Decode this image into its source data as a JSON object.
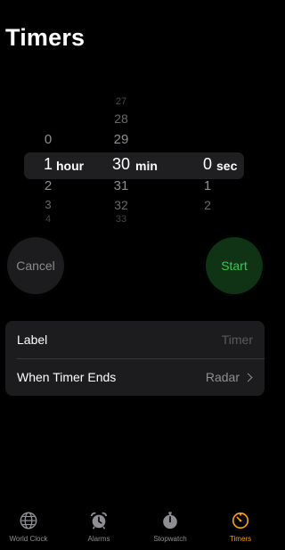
{
  "header": {
    "title": "Timers"
  },
  "picker": {
    "hours": {
      "above": [
        "0"
      ],
      "selected": "1",
      "unit": "hour",
      "below": [
        "2",
        "3",
        "4"
      ]
    },
    "minutes": {
      "above": [
        "27",
        "28",
        "29"
      ],
      "selected": "30",
      "unit": "min",
      "below": [
        "31",
        "32",
        "33"
      ]
    },
    "seconds": {
      "above": [],
      "selected": "0",
      "unit": "sec",
      "below": [
        "1",
        "2"
      ]
    }
  },
  "buttons": {
    "cancel": "Cancel",
    "start": "Start"
  },
  "settings": {
    "label": {
      "title": "Label",
      "placeholder": "Timer"
    },
    "when_timer_ends": {
      "title": "When Timer Ends",
      "value": "Radar"
    }
  },
  "tabbar": {
    "tabs": [
      {
        "label": "World Clock",
        "icon": "globe-icon"
      },
      {
        "label": "Alarms",
        "icon": "alarm-clock-icon"
      },
      {
        "label": "Stopwatch",
        "icon": "stopwatch-icon"
      },
      {
        "label": "Timers",
        "icon": "timer-icon",
        "active": true
      }
    ]
  },
  "colors": {
    "accent": "#ff9f0a",
    "start_green": "#35c759",
    "panel": "#1c1c1e"
  }
}
